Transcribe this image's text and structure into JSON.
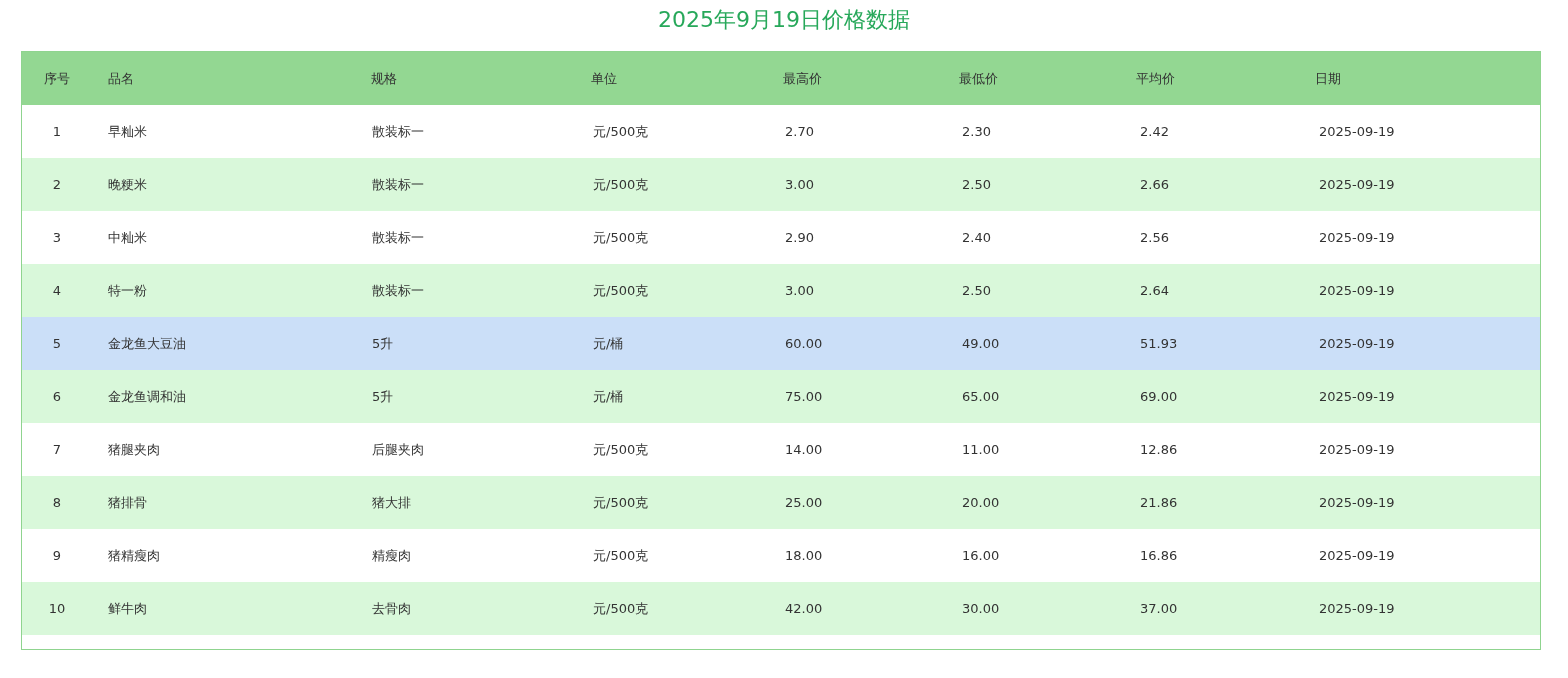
{
  "title": "2025年9月19日价格数据",
  "table": {
    "columns": [
      "序号",
      "品名",
      "规格",
      "单位",
      "最高价",
      "最低价",
      "平均价",
      "日期"
    ],
    "rows": [
      {
        "cells": [
          "1",
          "早籼米",
          "散装标一",
          "元/500克",
          "2.70",
          "2.30",
          "2.42",
          "2025-09-19"
        ],
        "selected": false
      },
      {
        "cells": [
          "2",
          "晚粳米",
          "散装标一",
          "元/500克",
          "3.00",
          "2.50",
          "2.66",
          "2025-09-19"
        ],
        "selected": false
      },
      {
        "cells": [
          "3",
          "中籼米",
          "散装标一",
          "元/500克",
          "2.90",
          "2.40",
          "2.56",
          "2025-09-19"
        ],
        "selected": false
      },
      {
        "cells": [
          "4",
          "特一粉",
          "散装标一",
          "元/500克",
          "3.00",
          "2.50",
          "2.64",
          "2025-09-19"
        ],
        "selected": false
      },
      {
        "cells": [
          "5",
          "金龙鱼大豆油",
          "5升",
          "元/桶",
          "60.00",
          "49.00",
          "51.93",
          "2025-09-19"
        ],
        "selected": true
      },
      {
        "cells": [
          "6",
          "金龙鱼调和油",
          "5升",
          "元/桶",
          "75.00",
          "65.00",
          "69.00",
          "2025-09-19"
        ],
        "selected": false
      },
      {
        "cells": [
          "7",
          "猪腿夹肉",
          "后腿夹肉",
          "元/500克",
          "14.00",
          "11.00",
          "12.86",
          "2025-09-19"
        ],
        "selected": false
      },
      {
        "cells": [
          "8",
          "猪排骨",
          "猪大排",
          "元/500克",
          "25.00",
          "20.00",
          "21.86",
          "2025-09-19"
        ],
        "selected": false
      },
      {
        "cells": [
          "9",
          "猪精瘦肉",
          "精瘦肉",
          "元/500克",
          "18.00",
          "16.00",
          "16.86",
          "2025-09-19"
        ],
        "selected": false
      },
      {
        "cells": [
          "10",
          "鲜牛肉",
          "去骨肉",
          "元/500克",
          "42.00",
          "30.00",
          "37.00",
          "2025-09-19"
        ],
        "selected": false
      }
    ]
  }
}
